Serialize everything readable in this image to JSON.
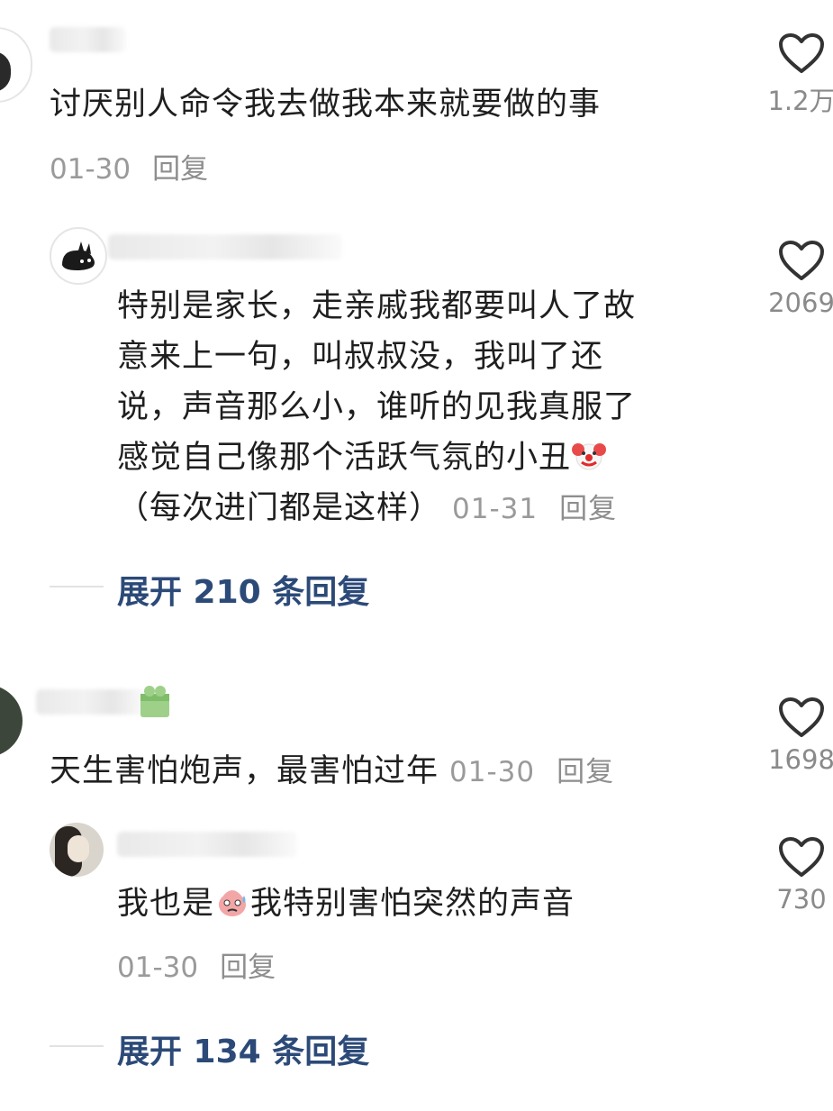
{
  "comments": [
    {
      "text": "讨厌别人命令我去做我本来就要做的事",
      "date": "01-30",
      "reply_label": "回复",
      "likes": "1.2万"
    },
    {
      "text_lines": [
        "特别是家长，走亲戚我都要叫人了故",
        "意来上一句，叫叔叔没，我叫了还",
        "说，声音那么小，谁听的见我真服了",
        "感觉自己像那个活跃气氛的小丑"
      ],
      "text_tail": "（每次进门都是这样）",
      "emoji": "clown-emoji",
      "date": "01-31",
      "reply_label": "回复",
      "likes": "2069"
    },
    {
      "text": "天生害怕炮声，最害怕过年",
      "date": "01-30",
      "reply_label": "回复",
      "likes": "1698"
    },
    {
      "text_before": "我也是",
      "text_after": "我特别害怕突然的声音",
      "emoji": "nervous-face-emoji",
      "date": "01-30",
      "reply_label": "回复",
      "likes": "730"
    }
  ],
  "expand_links": [
    {
      "label": "展开 210 条回复"
    },
    {
      "label": "展开 134 条回复"
    }
  ],
  "colors": {
    "link": "#2c4a78",
    "meta": "#9a9a9a",
    "text": "#1f1f1f"
  }
}
